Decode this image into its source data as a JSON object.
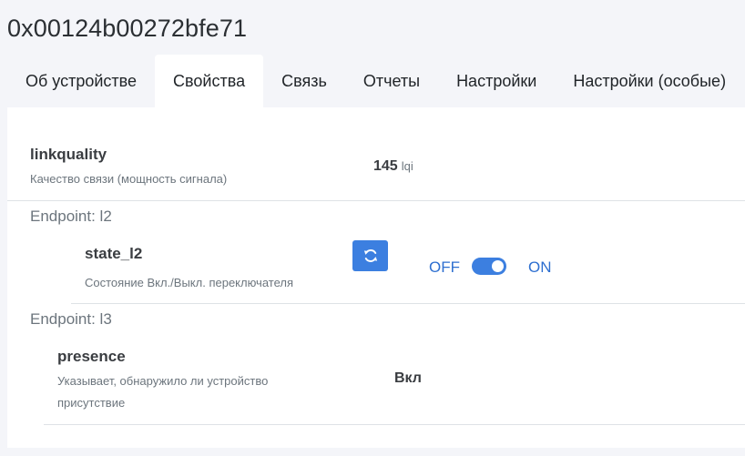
{
  "device": {
    "title": "0x00124b00272bfe71"
  },
  "tabs": [
    {
      "label": "Об устройстве"
    },
    {
      "label": "Свойства",
      "active": true
    },
    {
      "label": "Связь"
    },
    {
      "label": "Отчеты"
    },
    {
      "label": "Настройки"
    },
    {
      "label": "Настройки (особые)"
    }
  ],
  "properties": {
    "linkquality": {
      "name": "linkquality",
      "description": "Качество связи (мощность сигнала)",
      "value": "145",
      "unit": "lqi"
    },
    "endpoint_l2": {
      "label": "Endpoint: l2"
    },
    "state_l2": {
      "name": "state_l2",
      "description": "Состояние Вкл./Выкл. переключателя",
      "off_label": "OFF",
      "on_label": "ON",
      "state": "ON",
      "refresh_icon": "refresh-icon"
    },
    "endpoint_l3": {
      "label": "Endpoint: l3"
    },
    "presence": {
      "name": "presence",
      "description_line1": "Указывает, обнаружило ли устройство",
      "description_line2": "присутствие",
      "value": "Вкл"
    }
  },
  "colors": {
    "accent": "#3c7fe0",
    "page_background": "#f4f5f9",
    "card_background": "#ffffff"
  }
}
